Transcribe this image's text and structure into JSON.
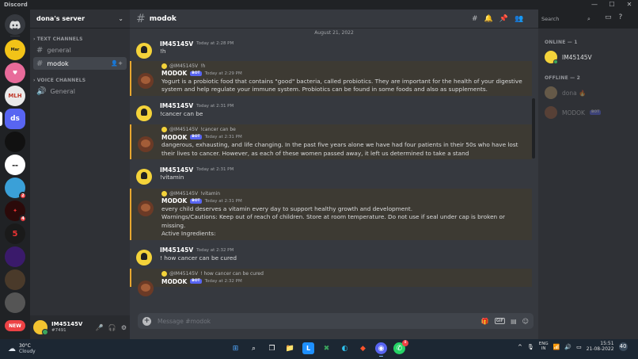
{
  "window": {
    "title": "Discord",
    "controls": [
      "—",
      "☐",
      "✕"
    ]
  },
  "guilds": {
    "items": [
      {
        "label": "",
        "color": "#5865f2",
        "icon": "discord-home-icon"
      },
      {
        "label": "Mar",
        "color": "#f2c318",
        "icon": "server-icon"
      },
      {
        "label": "",
        "color": "#e86b9a",
        "icon": "server-icon"
      },
      {
        "label": "MLH",
        "color": "#eaeaea",
        "icon": "server-icon"
      },
      {
        "label": "ds",
        "color": "#5865f2",
        "icon": "server-icon"
      },
      {
        "label": "",
        "color": "#111111",
        "icon": "server-icon"
      },
      {
        "label": "",
        "color": "#ffffff",
        "icon": "server-icon"
      },
      {
        "label": "",
        "color": "#3aa0d8",
        "badge": "2",
        "icon": "server-icon"
      },
      {
        "label": "",
        "color": "#2b0a0a",
        "badge": "4",
        "icon": "server-icon"
      },
      {
        "label": "5",
        "color": "#1a1a1a",
        "icon": "server-icon"
      },
      {
        "label": "",
        "color": "#3a1a6b",
        "icon": "server-icon"
      },
      {
        "label": "",
        "color": "#4a3a2a",
        "icon": "server-icon"
      },
      {
        "label": "",
        "color": "#555555",
        "icon": "server-icon"
      },
      {
        "label": "NEW",
        "color": "#ed4245",
        "icon": "server-icon"
      }
    ]
  },
  "server": {
    "name": "dona's server",
    "categories": {
      "text": "TEXT CHANNELS",
      "voice": "VOICE CHANNELS"
    },
    "text_channels": [
      "general",
      "modok"
    ],
    "voice_channels": [
      "General"
    ],
    "active_channel": "modok"
  },
  "user_panel": {
    "username": "IM45145V",
    "tag": "#7491"
  },
  "channel_header": {
    "name": "modok",
    "search_placeholder": "Search"
  },
  "chat": {
    "date_divider": "August 21, 2022",
    "messages": [
      {
        "author": "IM45145V",
        "time": "Today at 2:28 PM",
        "text": "!h",
        "bot": false
      },
      {
        "author": "MODOK",
        "badge": "BOT",
        "time": "Today at 2:29 PM",
        "reply_to": "@IM45145V",
        "reply_text": "!h",
        "text": "Yogurt is a probiotic food that contains \"good\" bacteria, called probiotics. They are important for the health of your digestive system and help regulate your immune system. Probiotics can be found in some foods and also as supplements.",
        "bot": true
      },
      {
        "author": "IM45145V",
        "time": "Today at 2:31 PM",
        "text": "!cancer can be",
        "bot": false
      },
      {
        "author": "MODOK",
        "badge": "BOT",
        "time": "Today at 2:31 PM",
        "reply_to": "@IM45145V",
        "reply_text": "!cancer can be",
        "text": "dangerous, exhausting, and life changing. In the past five years alone we have had four patients in their 50s who have lost their lives to cancer. However, as each of these women passed away, it left us determined to take a stand",
        "bot": true
      },
      {
        "author": "IM45145V",
        "time": "Today at 2:31 PM",
        "text": "!vitamin",
        "bot": false
      },
      {
        "author": "MODOK",
        "badge": "BOT",
        "time": "Today at 2:31 PM",
        "reply_to": "@IM45145V",
        "reply_text": "!vitamin",
        "text": "every child deserves a vitamin every day to support healthy growth and development.",
        "text2": "Warnings/Cautions: Keep out of reach of children. Store at room temperature. Do not use if seal under cap is broken or missing.",
        "text3": "Active Ingredients:",
        "bot": true
      },
      {
        "author": "IM45145V",
        "time": "Today at 2:32 PM",
        "text": "! how cancer can be cured",
        "bot": false
      },
      {
        "author": "MODOK",
        "badge": "BOT",
        "time": "Today at 2:32 PM",
        "reply_to": "@IM45145V",
        "reply_text": "! how cancer can be cured",
        "text": "",
        "bot": true
      }
    ],
    "composer_placeholder": "Message #modok",
    "gif_label": "GIF"
  },
  "members": {
    "online_header": "ONLINE — 1",
    "offline_header": "OFFLINE — 2",
    "online": [
      {
        "name": "IM45145V"
      }
    ],
    "offline": [
      {
        "name": "dona 🔥"
      },
      {
        "name": "MODOK",
        "badge": "BOT"
      }
    ]
  },
  "taskbar": {
    "weather_temp": "30°C",
    "weather_cond": "Cloudy",
    "lang_top": "ENG",
    "lang_bottom": "IN",
    "time": "15:51",
    "date": "21-08-2022",
    "notif_count": "40",
    "app_badge": "8"
  },
  "colors": {
    "accent": "#5865f2",
    "bot_highlight": "#e8a72f",
    "online": "#3ba55d"
  }
}
